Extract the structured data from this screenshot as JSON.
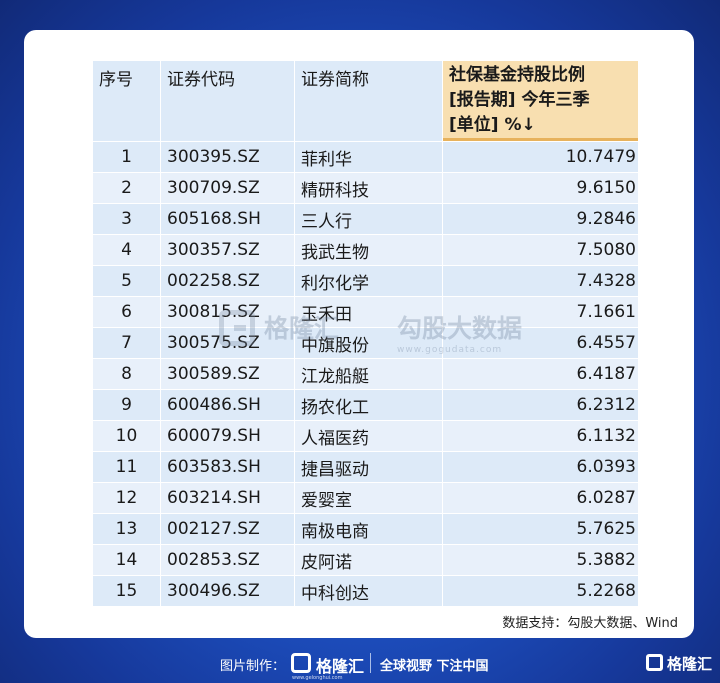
{
  "table": {
    "headers": {
      "index": "序号",
      "code": "证券代码",
      "name": "证券简称",
      "value_line1": "社保基金持股比例",
      "value_line2": "[报告期] 今年三季",
      "value_line3": "[单位] %↓"
    },
    "rows": [
      {
        "index": "1",
        "code": "300395.SZ",
        "name": "菲利华",
        "value": "10.7479"
      },
      {
        "index": "2",
        "code": "300709.SZ",
        "name": "精研科技",
        "value": "9.6150"
      },
      {
        "index": "3",
        "code": "605168.SH",
        "name": "三人行",
        "value": "9.2846"
      },
      {
        "index": "4",
        "code": "300357.SZ",
        "name": "我武生物",
        "value": "7.5080"
      },
      {
        "index": "5",
        "code": "002258.SZ",
        "name": "利尔化学",
        "value": "7.4328"
      },
      {
        "index": "6",
        "code": "300815.SZ",
        "name": "玉禾田",
        "value": "7.1661"
      },
      {
        "index": "7",
        "code": "300575.SZ",
        "name": "中旗股份",
        "value": "6.4557"
      },
      {
        "index": "8",
        "code": "300589.SZ",
        "name": "江龙船艇",
        "value": "6.4187"
      },
      {
        "index": "9",
        "code": "600486.SH",
        "name": "扬农化工",
        "value": "6.2312"
      },
      {
        "index": "10",
        "code": "600079.SH",
        "name": "人福医药",
        "value": "6.1132"
      },
      {
        "index": "11",
        "code": "603583.SH",
        "name": "捷昌驱动",
        "value": "6.0393"
      },
      {
        "index": "12",
        "code": "603214.SH",
        "name": "爱婴室",
        "value": "6.0287"
      },
      {
        "index": "13",
        "code": "002127.SZ",
        "name": "南极电商",
        "value": "5.7625"
      },
      {
        "index": "14",
        "code": "002853.SZ",
        "name": "皮阿诺",
        "value": "5.3882"
      },
      {
        "index": "15",
        "code": "300496.SZ",
        "name": "中科创达",
        "value": "5.2268"
      }
    ]
  },
  "watermark": {
    "brand": "格隆汇",
    "name": "勾股大数据",
    "url": "www.gogudata.com"
  },
  "source": "数据支持：勾股大数据、Wind",
  "footer": {
    "label": "图片制作：",
    "brand": "格隆汇",
    "brand_url": "www.gelonghui.com",
    "slogan": "全球视野 下注中国",
    "corner_brand": "格隆汇"
  },
  "colors": {
    "background": "#1d4fbf",
    "header_highlight": "#f8dfb0",
    "row_light": "#ddeaf8",
    "row_alt": "#e8f0fa"
  }
}
